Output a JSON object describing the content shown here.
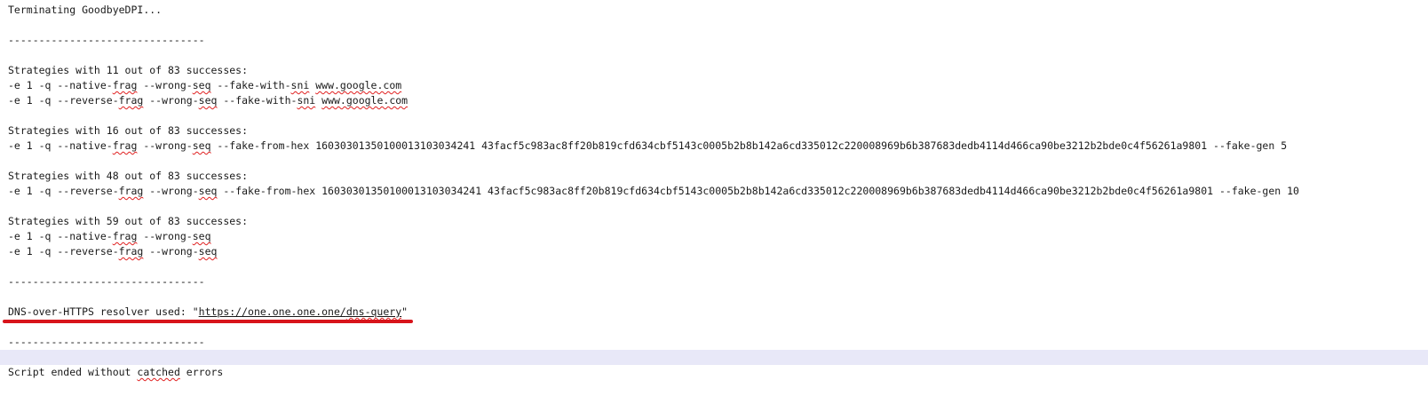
{
  "colors": {
    "background": "#ffffff",
    "text": "#1a1a1a",
    "current_line": "#e8e8f8",
    "annotation_underline": "#d8141b",
    "spellcheck": "#e02020"
  },
  "log": {
    "terminating": "Terminating GoodbyeDPI...",
    "separator": "--------------------------------",
    "group1": {
      "header": "Strategies with 11 out of 83 successes:",
      "lines": [
        "-e 1 -q --native-frag --wrong-seq --fake-with-sni www.google.com",
        "-e 1 -q --reverse-frag --wrong-seq --fake-with-sni www.google.com"
      ]
    },
    "group2": {
      "header": "Strategies with 16 out of 83 successes:",
      "lines": [
        "-e 1 -q --native-frag --wrong-seq --fake-from-hex 16030301350100013103034241 43facf5c983ac8ff20b819cfd634cbf5143c0005b2b8b142a6cd335012c220008969b6b387683dedb4114d466ca90be3212b2bde0c4f56261a9801 --fake-gen 5"
      ]
    },
    "group3": {
      "header": "Strategies with 48 out of 83 successes:",
      "lines": [
        "-e 1 -q --reverse-frag --wrong-seq --fake-from-hex 16030301350100013103034241 43facf5c983ac8ff20b819cfd634cbf5143c0005b2b8b142a6cd335012c220008969b6b387683dedb4114d466ca90be3212b2bde0c4f56261a9801 --fake-gen 10"
      ]
    },
    "group4": {
      "header": "Strategies with 59 out of 83 successes:",
      "lines": [
        "-e 1 -q --native-frag --wrong-seq",
        "-e 1 -q --reverse-frag --wrong-seq"
      ]
    },
    "dns_prefix": "DNS-over-HTTPS resolver used: \"",
    "dns_url": "https://one.one.one.one/dns-query",
    "dns_suffix": "\"",
    "end_prefix": "Script ended without ",
    "end_word": "catched",
    "end_suffix": " errors"
  }
}
